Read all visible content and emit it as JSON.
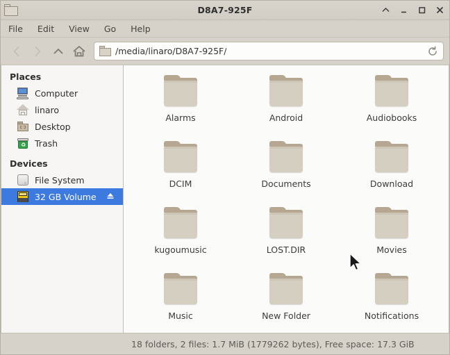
{
  "window": {
    "title": "D8A7-925F",
    "icon": "folder-icon",
    "buttons": [
      {
        "name": "shade-button",
        "glyph": "shade"
      },
      {
        "name": "minimize-button",
        "glyph": "minimize"
      },
      {
        "name": "maximize-button",
        "glyph": "maximize"
      },
      {
        "name": "close-button",
        "glyph": "close"
      }
    ]
  },
  "menubar": {
    "items": [
      {
        "label": "File"
      },
      {
        "label": "Edit"
      },
      {
        "label": "View"
      },
      {
        "label": "Go"
      },
      {
        "label": "Help"
      }
    ]
  },
  "toolbar": {
    "back": {
      "name": "back-button",
      "enabled": false
    },
    "forward": {
      "name": "forward-button",
      "enabled": false
    },
    "up": {
      "name": "up-button",
      "enabled": true
    },
    "home": {
      "name": "home-button",
      "enabled": true
    },
    "path": "/media/linaro/D8A7-925F/",
    "path_placeholder": "Location",
    "reload": {
      "name": "reload-button",
      "icon": "reload-icon"
    }
  },
  "sidebar": {
    "sections": [
      {
        "header": "Places",
        "items": [
          {
            "label": "Computer",
            "icon": "computer-icon",
            "selected": false
          },
          {
            "label": "linaro",
            "icon": "home-icon",
            "selected": false
          },
          {
            "label": "Desktop",
            "icon": "folder-icon",
            "selected": false
          },
          {
            "label": "Trash",
            "icon": "trash-icon",
            "selected": false
          }
        ]
      },
      {
        "header": "Devices",
        "items": [
          {
            "label": "File System",
            "icon": "harddisk-icon",
            "selected": false
          },
          {
            "label": "32 GB Volume",
            "icon": "flashcard-icon",
            "selected": true,
            "eject": true
          }
        ]
      }
    ]
  },
  "content": {
    "files": [
      {
        "name": "Alarms",
        "type": "folder"
      },
      {
        "name": "Android",
        "type": "folder"
      },
      {
        "name": "Audiobooks",
        "type": "folder"
      },
      {
        "name": "DCIM",
        "type": "folder"
      },
      {
        "name": "Documents",
        "type": "folder"
      },
      {
        "name": "Download",
        "type": "folder"
      },
      {
        "name": "kugoumusic",
        "type": "folder"
      },
      {
        "name": "LOST.DIR",
        "type": "folder"
      },
      {
        "name": "Movies",
        "type": "folder"
      },
      {
        "name": "Music",
        "type": "folder"
      },
      {
        "name": "New Folder",
        "type": "folder"
      },
      {
        "name": "Notifications",
        "type": "folder"
      }
    ]
  },
  "statusbar": {
    "text": "18 folders, 2 files: 1.7 MiB (1779262 bytes), Free space: 17.3 GiB"
  },
  "colors": {
    "selection_blue": "#3d7ae0",
    "titlebar": "#d6d2ca",
    "content_bg": "#fbfbfa",
    "folder_body": "#d5cfc2",
    "folder_tab": "#b5a791"
  }
}
